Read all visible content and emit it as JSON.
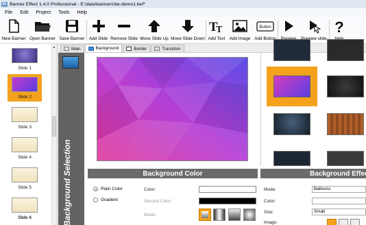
{
  "window": {
    "icon_text": "be",
    "title": "Banner Effect 1.4.0 Professional -  E:\\data\\banners\\be-demo1.bef*"
  },
  "menu": [
    "File",
    "Edit",
    "Project",
    "Tools",
    "Help"
  ],
  "toolbar": {
    "new_banner": "New Banner",
    "open_banner": "Open Banner",
    "save_banner": "Save Banner",
    "add_slide": "Add Slide",
    "remove_slide": "Remove Slide",
    "move_up": "Move Slide Up",
    "move_down": "Move Slide Down",
    "add_text": "Add Text",
    "add_image": "Add Image",
    "add_button": "Add Button",
    "button_icon_text": "Button",
    "preview": "Preview",
    "preview_slide": "Preview slide",
    "help": "Help"
  },
  "slides": [
    "Slide 1",
    "Slide 2",
    "Slide 3",
    "Slide 4",
    "Slide 5",
    "Slide 6",
    "Slide 6"
  ],
  "selected_slide": "Slide 2",
  "tabs": [
    "Main",
    "Background",
    "Border",
    "Transition"
  ],
  "active_tab": "Background",
  "vertical_label": "Background Selection",
  "background_color": {
    "header": "Background Color",
    "plain_color": "Plain Color",
    "gradient": "Gradient",
    "color_label": "Color:",
    "second_color_label": "Second Color:",
    "mode_label": "Mode:",
    "plain_selected": true
  },
  "background_effects": {
    "header": "Background Effects",
    "mode_label": "Mode:",
    "mode_value": "Balloons",
    "color_label": "Color:",
    "size_label": "Size:",
    "size_value": "Small",
    "image_label": "Image:"
  },
  "colors": {
    "accent": "#f4a21d",
    "header_gray": "#6b6b6b",
    "strip_gray": "#626262"
  }
}
